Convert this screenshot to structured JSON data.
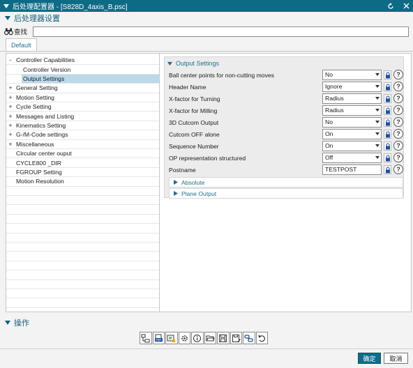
{
  "window": {
    "title": "后处理配置器 - [S828D_4axis_B.psc]"
  },
  "section_header": "后处理器设置",
  "search": {
    "label": "查找",
    "value": ""
  },
  "tabs": [
    {
      "label": "Default",
      "active": true
    }
  ],
  "tree": {
    "items": [
      {
        "label": "Controller Capabilities",
        "level": 0,
        "expander": "-",
        "selected": false
      },
      {
        "label": "Controller Version",
        "level": 1,
        "expander": "",
        "selected": false
      },
      {
        "label": "Output Settings",
        "level": 1,
        "expander": "",
        "selected": true
      },
      {
        "label": "General Setting",
        "level": 0,
        "expander": "+",
        "selected": false
      },
      {
        "label": "Motion Setting",
        "level": 0,
        "expander": "+",
        "selected": false
      },
      {
        "label": "Cycle Setting",
        "level": 0,
        "expander": "+",
        "selected": false
      },
      {
        "label": "Messages and Listing",
        "level": 0,
        "expander": "+",
        "selected": false
      },
      {
        "label": "Kinematics Setting",
        "level": 0,
        "expander": "+",
        "selected": false
      },
      {
        "label": "G-/M-Code settings",
        "level": 0,
        "expander": "+",
        "selected": false
      },
      {
        "label": "Miscellaneous",
        "level": 0,
        "expander": "+",
        "selected": false
      },
      {
        "label": "Circular center ouput",
        "level": 0,
        "expander": "",
        "selected": false
      },
      {
        "label": "CYCLE800 _DIR",
        "level": 0,
        "expander": "",
        "selected": false
      },
      {
        "label": "FGROUP Setting",
        "level": 0,
        "expander": "",
        "selected": false
      },
      {
        "label": "Motion Resolution",
        "level": 0,
        "expander": "",
        "selected": false
      }
    ]
  },
  "panel": {
    "title": "Output Settings",
    "properties": [
      {
        "label": "Ball center points for non-cutting moves",
        "value": "No",
        "kind": "select"
      },
      {
        "label": "Header Name",
        "value": "Ignore",
        "kind": "select"
      },
      {
        "label": "X-factor for Turning",
        "value": "Radius",
        "kind": "select"
      },
      {
        "label": "X-factor for Milling",
        "value": "Radius",
        "kind": "select"
      },
      {
        "label": "3D Cutcom Output",
        "value": "No",
        "kind": "select"
      },
      {
        "label": "Cutcom OFF alone",
        "value": "On",
        "kind": "select"
      },
      {
        "label": "Sequence Number",
        "value": "On",
        "kind": "select"
      },
      {
        "label": "OP representation structured",
        "value": "Off",
        "kind": "select"
      },
      {
        "label": "Postname",
        "value": "TESTPOST",
        "kind": "text"
      }
    ],
    "subgroups": [
      {
        "label": "Absolute"
      },
      {
        "label": "Plane Output"
      }
    ]
  },
  "actions_header": "操作",
  "toolbar_icons": [
    "tree-structure-icon",
    "def-file-icon",
    "configure-icon",
    "settings-gear-icon",
    "info-icon",
    "open-folder-icon",
    "save-icon",
    "save-as-icon",
    "link-icon",
    "undo-icon"
  ],
  "buttons": {
    "ok": "确定",
    "cancel": "取消"
  },
  "colors": {
    "titlebar": "#0d6b86",
    "accent_text": "#1f6f8f",
    "selection": "#bcd9ea",
    "primary_button": "#0f6e8c"
  }
}
